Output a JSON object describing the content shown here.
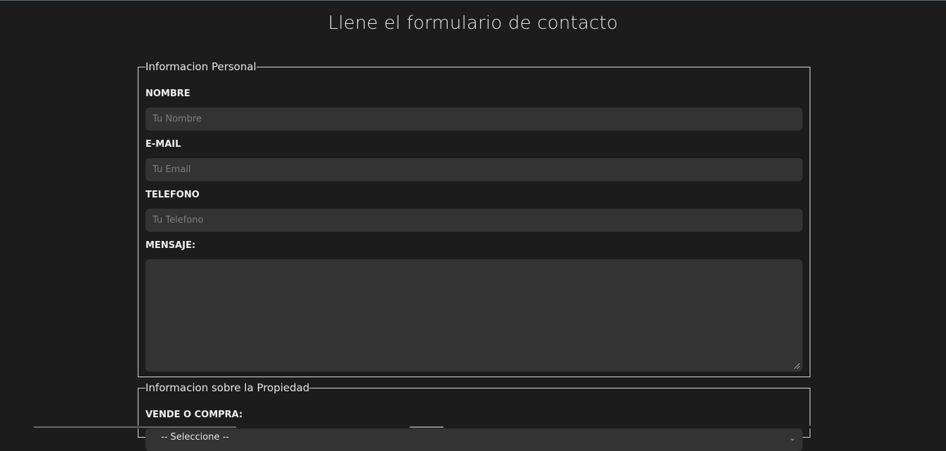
{
  "page": {
    "title": "Llene el formulario de contacto"
  },
  "personal": {
    "legend": "Informacion Personal",
    "nombre": {
      "label": "NOMBRE",
      "placeholder": "Tu Nombre"
    },
    "email": {
      "label": "E-MAIL",
      "placeholder": "Tu Email"
    },
    "telefono": {
      "label": "TELEFONO",
      "placeholder": "Tu Telefono"
    },
    "mensaje": {
      "label": "MENSAJE:"
    }
  },
  "property": {
    "legend": "Informacion sobre la Propiedad",
    "vende_compra": {
      "label": "VENDE O COMPRA:",
      "selected": "-- Seleccione --"
    }
  },
  "icons": {
    "select_arrow": "chevron-down-icon",
    "textarea_resize": "resize-grip-icon"
  },
  "colors": {
    "background": "#1c1c1c",
    "input_background": "#333333",
    "border": "#d8d8d8"
  }
}
